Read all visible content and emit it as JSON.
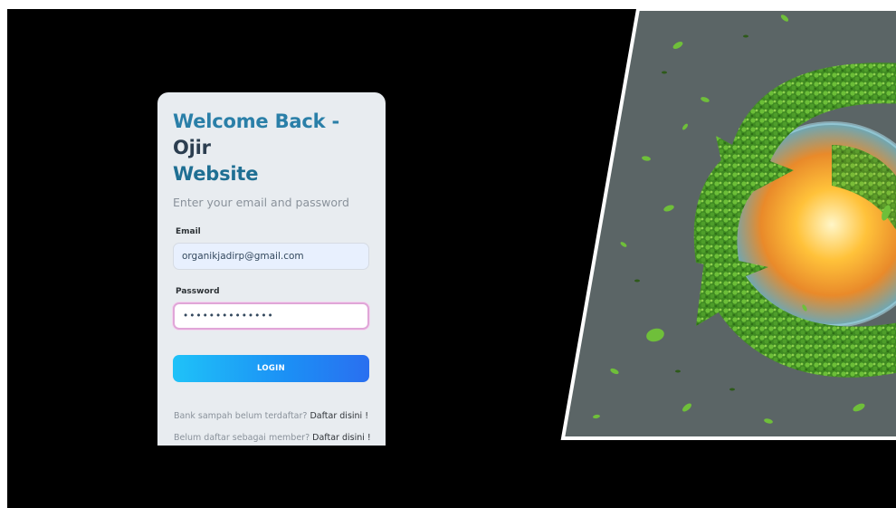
{
  "login": {
    "title_part1": "Welcome Back - ",
    "title_part2": "Ojir",
    "title_part3": "Website",
    "subtitle": "Enter your email and password",
    "email_label": "Email",
    "email_value": "organikjadirp@gmail.com",
    "password_label": "Password",
    "password_value": "••••••••••••••",
    "login_button": "LOGIN",
    "bank_prompt": "Bank sampah belum terdaftar?",
    "bank_link": "Daftar disini !",
    "member_prompt": "Belum daftar sebagai member?",
    "member_link": "Daftar disini !"
  },
  "colors": {
    "card_bg": "#e8ecf0",
    "title_accent": "#2a7fa8",
    "button_gradient_start": "#1fc2f8",
    "button_gradient_end": "#2a6ff0",
    "focus_border": "#e0a6d8",
    "hero_bg": "#5a6465",
    "leaf_green": "#4f9e2c"
  },
  "hero": {
    "icon": "recycle-leaves-globe-icon"
  }
}
